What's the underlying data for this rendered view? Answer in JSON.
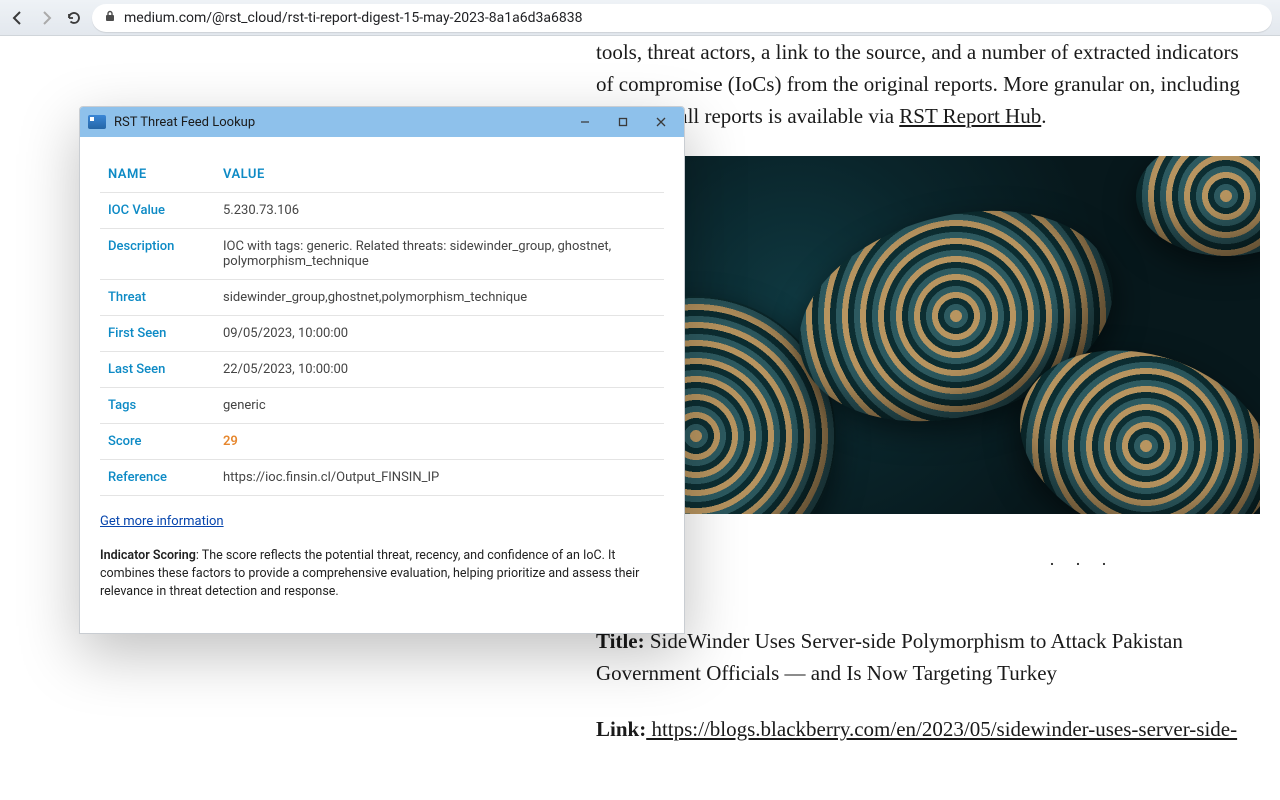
{
  "browser": {
    "url": "medium.com/@rst_cloud/rst-ti-report-digest-15-may-2023-8a1a6d3a6838"
  },
  "article": {
    "intro_tail": "tools, threat actors, a link to the source, and a number of extracted indicators of compromise (IoCs) from the original reports. More granular on, including TTPs, on all reports is available via ",
    "intro_link_text": "RST Report Hub",
    "intro_period": ".",
    "title_label": "Title:",
    "title_text": " SideWinder Uses Server-side Polymorphism to Attack Pakistan Government Officials — and Is Now Targeting Turkey",
    "link_label": "Link:",
    "link_text": " https://blogs.blackberry.com/en/2023/05/sidewinder-uses-server-side-"
  },
  "popup": {
    "window_title": "RST Threat Feed Lookup",
    "headers": {
      "name": "NAME",
      "value": "VALUE"
    },
    "rows": {
      "ioc_value": {
        "k": "IOC Value",
        "v": "5.230.73.106"
      },
      "description": {
        "k": "Description",
        "v": "IOC with tags: generic. Related threats: sidewinder_group, ghostnet, polymorphism_technique"
      },
      "threat": {
        "k": "Threat",
        "v": "sidewinder_group,ghostnet,polymorphism_technique"
      },
      "first_seen": {
        "k": "First Seen",
        "v": "09/05/2023, 10:00:00"
      },
      "last_seen": {
        "k": "Last Seen",
        "v": "22/05/2023, 10:00:00"
      },
      "tags": {
        "k": "Tags",
        "v": "generic"
      },
      "score": {
        "k": "Score",
        "v": "29"
      },
      "reference": {
        "k": "Reference",
        "v": "https://ioc.finsin.cl/Output_FINSIN_IP"
      }
    },
    "get_more": "Get more information",
    "scoring_label": "Indicator Scoring",
    "scoring_text": ": The score reflects the potential threat, recency, and confidence of an IoC. It combines these factors to provide a comprehensive evaluation, helping prioritize and assess their relevance in threat detection and response."
  }
}
